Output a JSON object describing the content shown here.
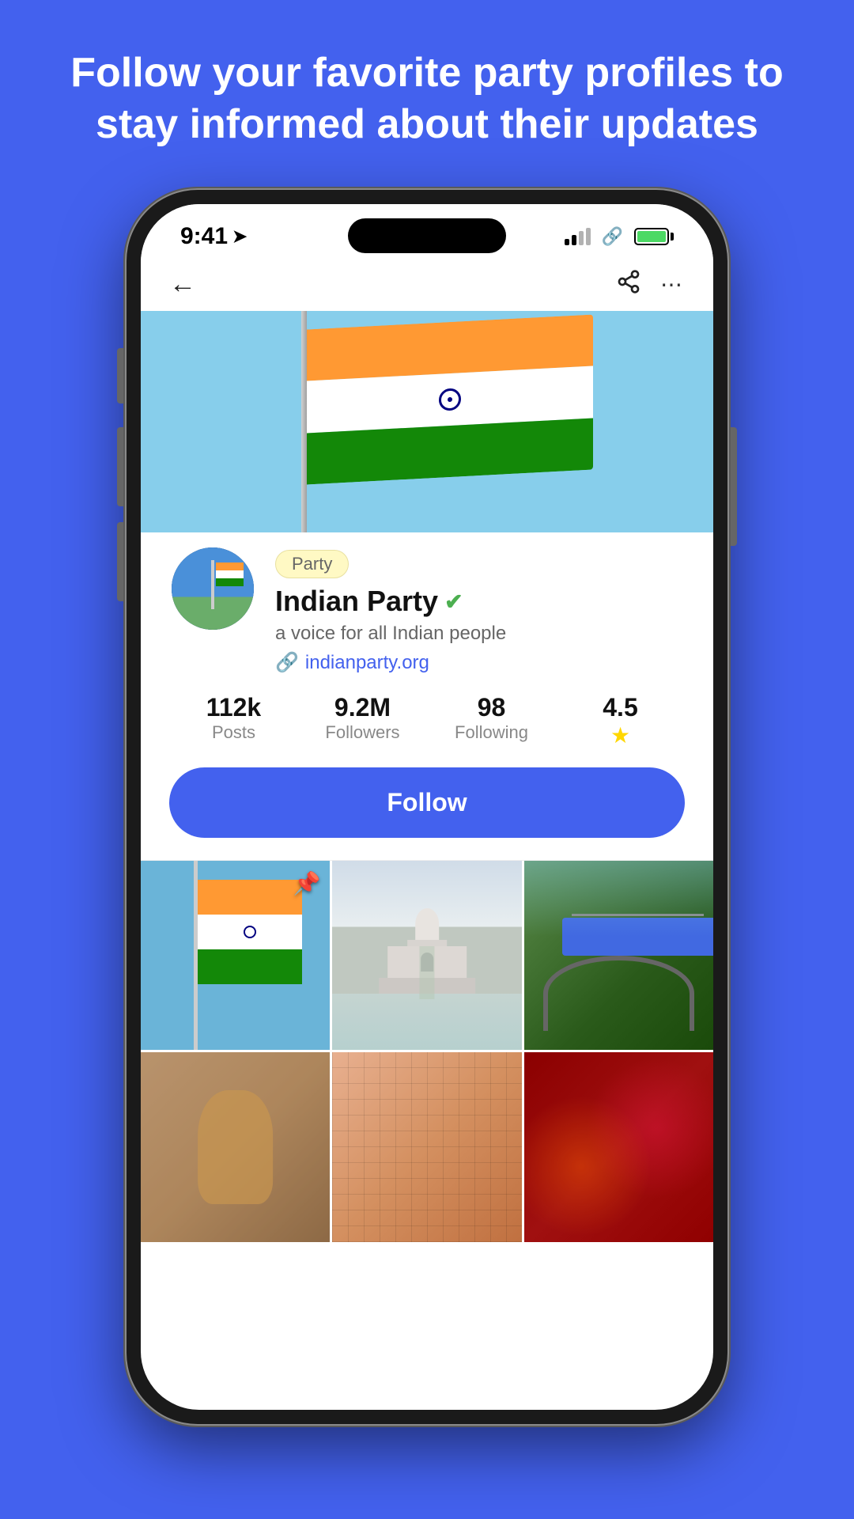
{
  "page": {
    "background_color": "#4361EE",
    "headline": "Follow your favorite party profiles to stay informed about their updates"
  },
  "status_bar": {
    "time": "9:41",
    "signal_label": "signal",
    "link_label": "link",
    "battery_label": "battery"
  },
  "navbar": {
    "back_label": "←",
    "share_label": "share",
    "more_label": "more"
  },
  "profile": {
    "badge": "Party",
    "name": "Indian Party",
    "verified": true,
    "bio": "a voice for all Indian people",
    "website": "indianparty.org",
    "stats": {
      "posts_value": "112k",
      "posts_label": "Posts",
      "followers_value": "9.2M",
      "followers_label": "Followers",
      "following_value": "98",
      "following_label": "Following",
      "rating_value": "4.5",
      "rating_label": "★"
    },
    "follow_button": "Follow"
  },
  "grid": {
    "items": [
      {
        "type": "flag",
        "pinned": true
      },
      {
        "type": "taj",
        "pinned": false
      },
      {
        "type": "train",
        "pinned": false
      },
      {
        "type": "dance",
        "pinned": false
      },
      {
        "type": "jali",
        "pinned": false
      },
      {
        "type": "holi",
        "pinned": false
      }
    ]
  }
}
